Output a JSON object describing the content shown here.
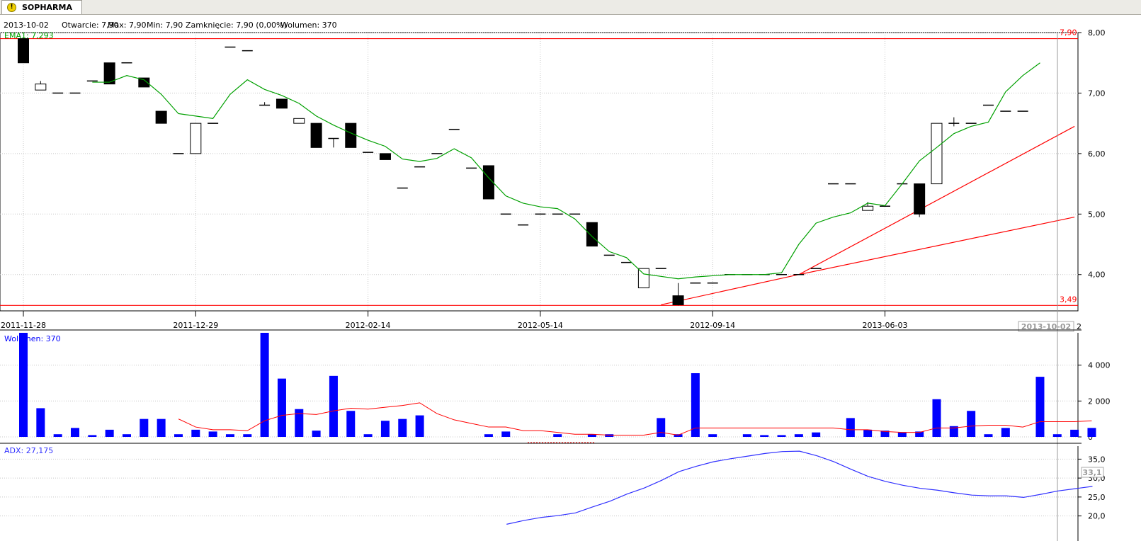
{
  "tab": {
    "title": "SOPHARMA",
    "icon": "warning-icon"
  },
  "info_line": {
    "date": "2013-10-02",
    "open": "Otwarcie: 7,90",
    "max": "Max: 7,90",
    "min": "Min: 7,90",
    "close": "Zamknięcie: 7,90 (0,00%)",
    "volume": "Wolumen: 370"
  },
  "price_panel": {
    "ema_label": "EMA1: 7,293",
    "level_top": "7,90",
    "level_bottom": "3,49",
    "y_ticks": [
      "8,00",
      "7,00",
      "6,00",
      "5,00",
      "4,00"
    ],
    "x_ticks": [
      "2011-11-28",
      "2011-12-29",
      "2012-02-14",
      "2012-05-14",
      "2012-09-14",
      "2013-06-03"
    ],
    "last_date": "2013-10-02",
    "last_date_tail": "2"
  },
  "volume_panel": {
    "label": "Wolumen: 370",
    "y_ticks": [
      "4 000",
      "2 000",
      "0"
    ]
  },
  "adx_panel": {
    "label": "ADX: 27,175",
    "y_ticks": [
      "35,0",
      "30,0",
      "25,0",
      "20,0"
    ],
    "current_value": "33,1"
  },
  "colors": {
    "up": "#ffffff",
    "down": "#000000",
    "ema": "#00a000",
    "level": "#ff0000",
    "volume": "#0000ff",
    "adx": "#3030ff"
  },
  "chart_data": [
    {
      "type": "candlestick",
      "categories": [
        "2011-11-28",
        "2011-12-29",
        "2012-02-14",
        "2012-05-14",
        "2012-09-14",
        "2013-06-03",
        "2013-10-02"
      ],
      "ylim": [
        3.4,
        8.0
      ],
      "candles": [
        {
          "o": 7.9,
          "h": 7.9,
          "l": 7.5,
          "c": 7.5
        },
        {
          "o": 7.05,
          "h": 7.2,
          "l": 7.05,
          "c": 7.15
        },
        {
          "o": 7.0,
          "h": 7.0,
          "l": 7.0,
          "c": 7.0
        },
        {
          "o": 7.0,
          "h": 7.0,
          "l": 7.0,
          "c": 7.0
        },
        {
          "o": 7.2,
          "h": 7.2,
          "l": 7.2,
          "c": 7.2
        },
        {
          "o": 7.5,
          "h": 7.5,
          "l": 7.15,
          "c": 7.15
        },
        {
          "o": 7.5,
          "h": 7.5,
          "l": 7.5,
          "c": 7.5
        },
        {
          "o": 7.25,
          "h": 7.25,
          "l": 7.1,
          "c": 7.1
        },
        {
          "o": 6.7,
          "h": 6.7,
          "l": 6.5,
          "c": 6.5
        },
        {
          "o": 6.0,
          "h": 6.0,
          "l": 6.0,
          "c": 6.0
        },
        {
          "o": 6.0,
          "h": 6.5,
          "l": 6.0,
          "c": 6.5
        },
        {
          "o": 6.5,
          "h": 6.5,
          "l": 6.5,
          "c": 6.5
        },
        {
          "o": 7.76,
          "h": 7.76,
          "l": 7.76,
          "c": 7.76
        },
        {
          "o": 7.7,
          "h": 7.7,
          "l": 7.7,
          "c": 7.7
        },
        {
          "o": 6.8,
          "h": 6.85,
          "l": 6.8,
          "c": 6.8
        },
        {
          "o": 6.9,
          "h": 6.9,
          "l": 6.75,
          "c": 6.75
        },
        {
          "o": 6.5,
          "h": 6.58,
          "l": 6.5,
          "c": 6.58
        },
        {
          "o": 6.5,
          "h": 6.5,
          "l": 6.1,
          "c": 6.1
        },
        {
          "o": 6.25,
          "h": 6.25,
          "l": 6.1,
          "c": 6.25
        },
        {
          "o": 6.5,
          "h": 6.5,
          "l": 6.1,
          "c": 6.1
        },
        {
          "o": 6.02,
          "h": 6.02,
          "l": 6.02,
          "c": 6.02
        },
        {
          "o": 6.0,
          "h": 6.0,
          "l": 5.9,
          "c": 5.9
        },
        {
          "o": 5.43,
          "h": 5.43,
          "l": 5.43,
          "c": 5.43
        },
        {
          "o": 5.78,
          "h": 5.78,
          "l": 5.78,
          "c": 5.78
        },
        {
          "o": 6.0,
          "h": 6.0,
          "l": 6.0,
          "c": 6.0
        },
        {
          "o": 6.4,
          "h": 6.4,
          "l": 6.4,
          "c": 6.4
        },
        {
          "o": 5.76,
          "h": 5.76,
          "l": 5.76,
          "c": 5.76
        },
        {
          "o": 5.8,
          "h": 5.8,
          "l": 5.25,
          "c": 5.25
        },
        {
          "o": 5.0,
          "h": 5.0,
          "l": 5.0,
          "c": 5.0
        },
        {
          "o": 4.82,
          "h": 4.82,
          "l": 4.82,
          "c": 4.82
        },
        {
          "o": 5.0,
          "h": 5.0,
          "l": 5.0,
          "c": 5.0
        },
        {
          "o": 5.0,
          "h": 5.0,
          "l": 5.0,
          "c": 5.0
        },
        {
          "o": 5.0,
          "h": 5.0,
          "l": 5.0,
          "c": 5.0
        },
        {
          "o": 4.86,
          "h": 4.86,
          "l": 4.47,
          "c": 4.47
        },
        {
          "o": 4.32,
          "h": 4.32,
          "l": 4.32,
          "c": 4.32
        },
        {
          "o": 4.2,
          "h": 4.2,
          "l": 4.2,
          "c": 4.2
        },
        {
          "o": 3.78,
          "h": 4.1,
          "l": 3.78,
          "c": 4.1
        },
        {
          "o": 4.1,
          "h": 4.1,
          "l": 4.1,
          "c": 4.1
        },
        {
          "o": 3.65,
          "h": 3.86,
          "l": 3.49,
          "c": 3.5
        },
        {
          "o": 3.86,
          "h": 3.86,
          "l": 3.86,
          "c": 3.86
        },
        {
          "o": 3.86,
          "h": 3.86,
          "l": 3.86,
          "c": 3.86
        },
        {
          "o": 4.0,
          "h": 4.0,
          "l": 4.0,
          "c": 4.0
        },
        {
          "o": 4.0,
          "h": 4.0,
          "l": 4.0,
          "c": 4.0
        },
        {
          "o": 4.0,
          "h": 4.0,
          "l": 4.0,
          "c": 4.0
        },
        {
          "o": 4.0,
          "h": 4.0,
          "l": 4.0,
          "c": 4.0
        },
        {
          "o": 4.0,
          "h": 4.0,
          "l": 4.0,
          "c": 4.0
        },
        {
          "o": 4.1,
          "h": 4.1,
          "l": 4.1,
          "c": 4.1
        },
        {
          "o": 5.5,
          "h": 5.5,
          "l": 5.5,
          "c": 5.5
        },
        {
          "o": 5.5,
          "h": 5.5,
          "l": 5.5,
          "c": 5.5
        },
        {
          "o": 5.06,
          "h": 5.2,
          "l": 5.06,
          "c": 5.13
        },
        {
          "o": 5.13,
          "h": 5.13,
          "l": 5.13,
          "c": 5.13
        },
        {
          "o": 5.5,
          "h": 5.5,
          "l": 5.5,
          "c": 5.5
        },
        {
          "o": 5.5,
          "h": 5.5,
          "l": 4.95,
          "c": 5.0
        },
        {
          "o": 5.5,
          "h": 6.5,
          "l": 5.5,
          "c": 6.5
        },
        {
          "o": 6.5,
          "h": 6.6,
          "l": 6.45,
          "c": 6.5
        },
        {
          "o": 6.5,
          "h": 6.5,
          "l": 6.5,
          "c": 6.5
        },
        {
          "o": 6.8,
          "h": 6.8,
          "l": 6.8,
          "c": 6.8
        },
        {
          "o": 6.7,
          "h": 6.7,
          "l": 6.7,
          "c": 6.7
        },
        {
          "o": 6.7,
          "h": 6.7,
          "l": 6.7,
          "c": 6.7
        }
      ],
      "ema": [
        null,
        null,
        null,
        null,
        7.18,
        7.18,
        7.29,
        7.22,
        6.98,
        6.66,
        6.62,
        6.58,
        6.98,
        7.22,
        7.06,
        6.96,
        6.83,
        6.62,
        6.47,
        6.34,
        6.22,
        6.12,
        5.91,
        5.87,
        5.92,
        6.08,
        5.93,
        5.6,
        5.3,
        5.18,
        5.12,
        5.09,
        4.92,
        4.63,
        4.38,
        4.28,
        4.01,
        3.97,
        3.93,
        3.96,
        3.98,
        4.0,
        4.0,
        4.0,
        4.03,
        4.5,
        4.85,
        4.95,
        5.02,
        5.18,
        5.14,
        5.5,
        5.88,
        6.1,
        6.33,
        6.45,
        6.52,
        7.02,
        7.29,
        7.5
      ],
      "support_lines": [
        {
          "from": [
            37,
            3.5
          ],
          "to": [
            45,
            4.0
          ],
          "to2": [
            61,
            6.45
          ]
        },
        {
          "from": [
            45,
            4.0
          ],
          "to": [
            61,
            4.95
          ]
        }
      ]
    },
    {
      "type": "bar",
      "title": "Wolumen: 370",
      "ylim": [
        0,
        5800
      ],
      "values": [
        5800,
        1600,
        150,
        500,
        100,
        400,
        150,
        1000,
        1000,
        150,
        400,
        300,
        150,
        150,
        5800,
        3250,
        1550,
        350,
        3400,
        1450,
        150,
        900,
        1000,
        1200,
        0,
        0,
        0,
        150,
        300,
        0,
        0,
        150,
        0,
        150,
        150,
        0,
        0,
        1050,
        150,
        3550,
        150,
        0,
        150,
        100,
        100,
        150,
        250,
        0,
        1050,
        400,
        350,
        250,
        300,
        2100,
        600,
        1450,
        150,
        500,
        0,
        3350,
        150,
        400,
        500
      ],
      "ma": [
        null,
        null,
        null,
        null,
        null,
        null,
        null,
        null,
        null,
        1000,
        550,
        400,
        400,
        350,
        900,
        1200,
        1300,
        1250,
        1450,
        1600,
        1550,
        1650,
        1750,
        1900,
        1300,
        950,
        750,
        550,
        550,
        350,
        350,
        250,
        150,
        150,
        100,
        100,
        100,
        250,
        100,
        500,
        500,
        500,
        500,
        500,
        500,
        500,
        500,
        500,
        400,
        400,
        300,
        250,
        250,
        500,
        500,
        600,
        650,
        650,
        550,
        850,
        850,
        850,
        900
      ]
    },
    {
      "type": "line",
      "title": "ADX: 27,175",
      "ylim": [
        17.5,
        37.5
      ],
      "values": [
        null,
        null,
        null,
        null,
        null,
        null,
        null,
        null,
        null,
        null,
        null,
        null,
        null,
        null,
        null,
        null,
        null,
        null,
        null,
        null,
        null,
        null,
        null,
        null,
        null,
        null,
        null,
        null,
        17.8,
        18.8,
        19.6,
        20.1,
        20.8,
        22.4,
        23.9,
        25.8,
        27.4,
        29.4,
        31.7,
        33.1,
        34.3,
        35.1,
        35.8,
        36.5,
        37.0,
        37.1,
        35.9,
        34.3,
        32.3,
        30.4,
        29.1,
        28.1,
        27.3,
        26.8,
        26.1,
        25.5,
        25.3,
        25.3,
        24.9,
        25.7,
        26.6,
        27.2,
        27.8
      ]
    }
  ]
}
